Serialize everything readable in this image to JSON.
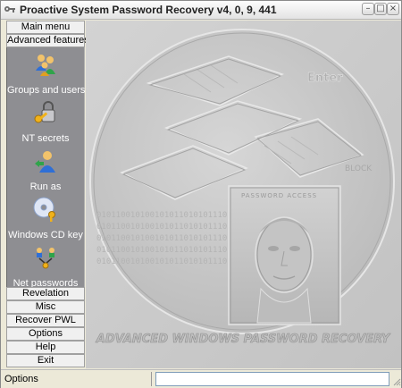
{
  "window": {
    "title": "Proactive System Password Recovery v4, 0, 9, 441",
    "minimize_glyph": "–",
    "maximize_glyph": "□",
    "close_glyph": "×"
  },
  "sidebar": {
    "top_buttons": [
      {
        "label": "Main menu"
      },
      {
        "label": "Advanced features"
      }
    ],
    "panel_items": [
      {
        "label": "Groups and users",
        "icon": "users-group-icon"
      },
      {
        "label": "NT secrets",
        "icon": "lock-key-icon"
      },
      {
        "label": "Run as",
        "icon": "run-as-user-icon"
      },
      {
        "label": "Windows CD key",
        "icon": "cd-key-icon"
      },
      {
        "label": "Net passwords",
        "icon": "network-users-icon"
      }
    ],
    "bottom_buttons": [
      {
        "label": "Revelation"
      },
      {
        "label": "Misc"
      },
      {
        "label": "Recover PWL"
      },
      {
        "label": "Options"
      },
      {
        "label": "Help"
      },
      {
        "label": "Exit"
      }
    ]
  },
  "splash": {
    "bottom_caption": "ADVANCED WINDOWS PASSWORD RECOVERY",
    "inner_caption": "PASSWORD ACCESS",
    "binary_text": "010110010100101011010101110",
    "corner_text": "BLOCK",
    "top_right_text": "Enter"
  },
  "status": {
    "label": "Options",
    "field_value": ""
  },
  "colors": {
    "panel_bg": "#8e8e92",
    "titlebar": "#e9e9e9",
    "canvas_bg": "#c9c9c9"
  }
}
